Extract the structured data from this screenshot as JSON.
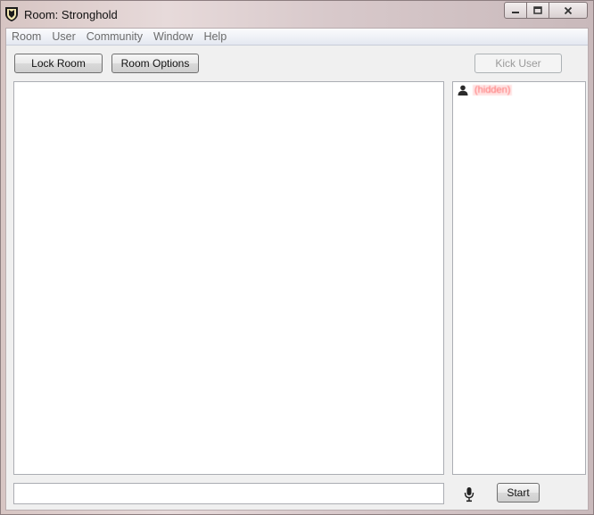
{
  "window": {
    "title": "Room: Stronghold"
  },
  "menu": [
    {
      "label": "Room"
    },
    {
      "label": "User"
    },
    {
      "label": "Community"
    },
    {
      "label": "Window"
    },
    {
      "label": "Help"
    }
  ],
  "toolbar": {
    "lock_room": "Lock Room",
    "room_options": "Room Options",
    "kick_user": "Kick User"
  },
  "users": [
    {
      "name": "(hidden)",
      "icon": "person-icon",
      "color": "#ff6f6f"
    }
  ],
  "message_input": {
    "value": "",
    "placeholder": ""
  },
  "voice": {
    "icon": "microphone-icon",
    "start_label": "Start"
  }
}
